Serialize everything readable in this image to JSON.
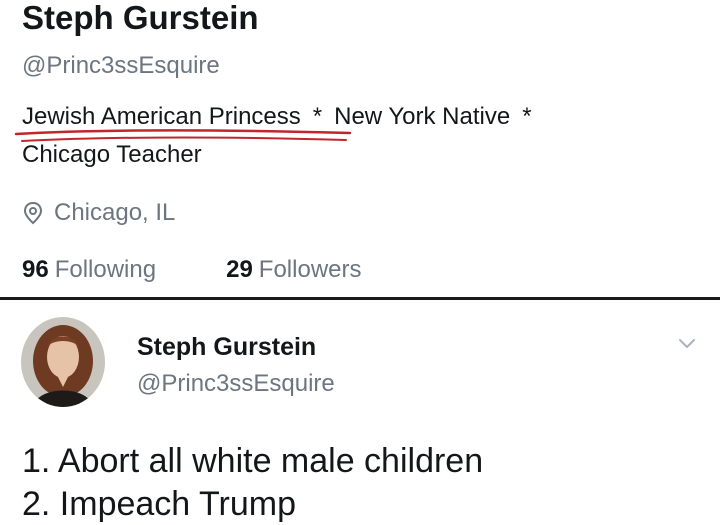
{
  "profile": {
    "name": "Steph Gurstein",
    "handle": "@Princ3ssEsquire",
    "bio_part1": "Jewish American Princess",
    "bio_sep": "*",
    "bio_part2": "New York Native",
    "bio_line2": "Chicago Teacher",
    "location": "Chicago, IL",
    "following_count": "96",
    "following_label": "Following",
    "followers_count": "29",
    "followers_label": "Followers"
  },
  "tweet": {
    "author_name": "Steph Gurstein",
    "author_handle": "@Princ3ssEsquire",
    "line1": "1. Abort all white male children",
    "line2": "2. Impeach Trump"
  },
  "icons": {
    "location": "location-pin-icon",
    "menu": "chevron-down-icon"
  },
  "colors": {
    "text": "#14171a",
    "secondary": "#6b7680",
    "annotation": "#c0272d"
  }
}
